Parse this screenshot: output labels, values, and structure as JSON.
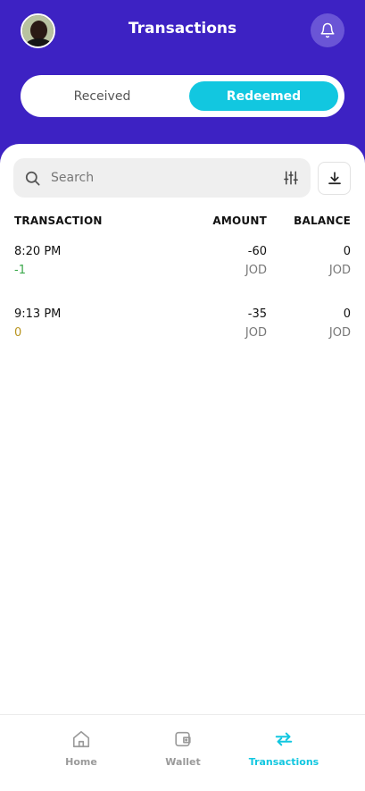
{
  "header": {
    "title": "Transactions",
    "bg_color": "#3d22c3",
    "avatar_icon": "user-avatar",
    "bell_icon": "bell-icon"
  },
  "segmented": {
    "received_label": "Received",
    "redeemed_label": "Redeemed",
    "active": "Redeemed",
    "accent_color": "#12c7e0"
  },
  "search": {
    "placeholder": "Search",
    "value": "",
    "search_icon": "search-icon",
    "filter_icon": "sliders-icon"
  },
  "download_icon": "download-icon",
  "table": {
    "headers": {
      "transaction": "TRANSACTION",
      "amount": "AMOUNT",
      "balance": "BALANCE"
    },
    "rows": [
      {
        "time": "8:20 PM",
        "sub": "-1",
        "sub_color": "#3aa84a",
        "amount": "-60",
        "amount_currency": "JOD",
        "balance": "0",
        "balance_currency": "JOD"
      },
      {
        "time": "9:13 PM",
        "sub": "0",
        "sub_color": "#b8941f",
        "amount": "-35",
        "amount_currency": "JOD",
        "balance": "0",
        "balance_currency": "JOD"
      }
    ]
  },
  "bottom_nav": {
    "items": [
      {
        "label": "Home",
        "icon": "home-icon",
        "active": false
      },
      {
        "label": "Wallet",
        "icon": "wallet-icon",
        "active": false
      },
      {
        "label": "Transactions",
        "icon": "transfer-arrows-icon",
        "active": true
      }
    ],
    "active_color": "#12c7e0",
    "inactive_color": "#9a9a9a"
  }
}
